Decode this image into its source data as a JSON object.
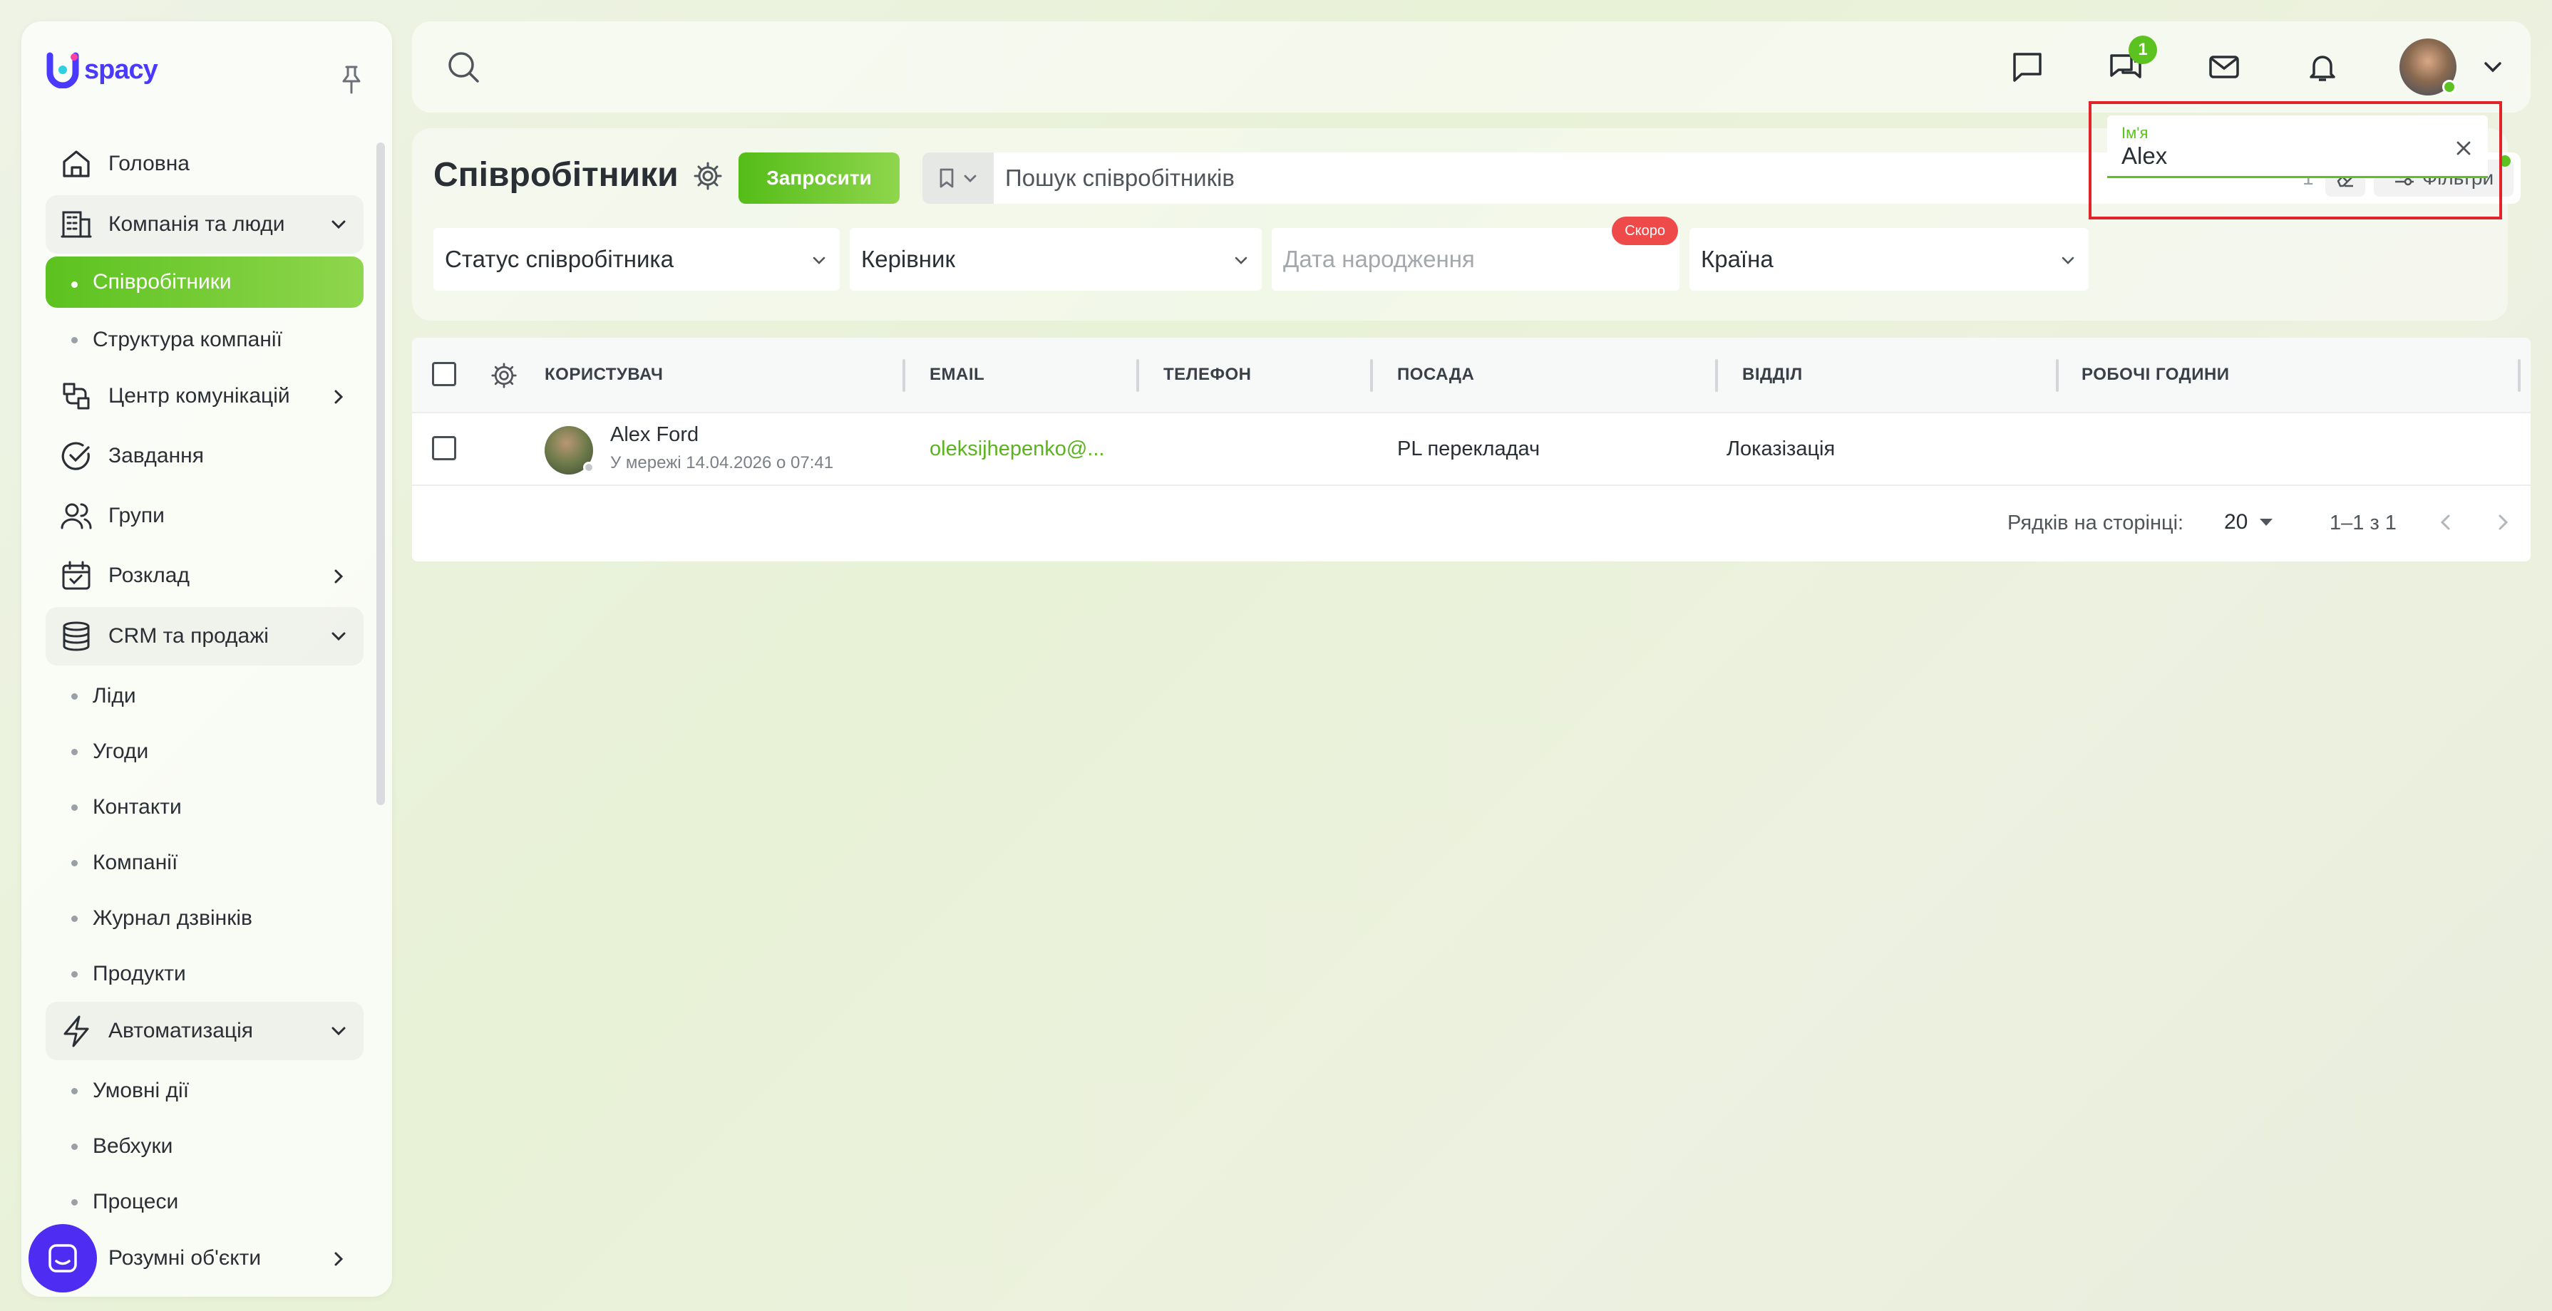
{
  "brand": {
    "logo_text": "spacy",
    "accent": "#5cc21f",
    "brand_color": "#4a3aff"
  },
  "sidebar": {
    "items": [
      {
        "label": "Головна",
        "icon": "home-icon"
      },
      {
        "label": "Компанія та люди",
        "icon": "building-icon",
        "expanded": true
      },
      {
        "label": "Співробітники",
        "sub": true,
        "active": true
      },
      {
        "label": "Структура компанії",
        "sub": true
      },
      {
        "label": "Центр комунікацій",
        "icon": "communication-icon"
      },
      {
        "label": "Завдання",
        "icon": "task-check-icon"
      },
      {
        "label": "Групи",
        "icon": "users-icon"
      },
      {
        "label": "Розклад",
        "icon": "calendar-icon"
      },
      {
        "label": "CRM та продажі",
        "icon": "database-icon",
        "expanded": true
      },
      {
        "label": "Ліди",
        "sub": true
      },
      {
        "label": "Угоди",
        "sub": true
      },
      {
        "label": "Контакти",
        "sub": true
      },
      {
        "label": "Компанії",
        "sub": true
      },
      {
        "label": "Журнал дзвінків",
        "sub": true
      },
      {
        "label": "Продукти",
        "sub": true
      },
      {
        "label": "Автоматизація",
        "icon": "lightning-icon",
        "expanded": true
      },
      {
        "label": "Умовні дії",
        "sub": true
      },
      {
        "label": "Вебхуки",
        "sub": true
      },
      {
        "label": "Процеси",
        "sub": true
      },
      {
        "label": "Розумні об'єкти",
        "icon": "smart-object-icon"
      }
    ]
  },
  "topbar": {
    "chat_badge": "1"
  },
  "page": {
    "title": "Співробітники",
    "invite_label": "Запросити",
    "search_placeholder": "Пошук співробітників",
    "search_count": "1",
    "filters_label": "Фільтри"
  },
  "filters": {
    "status": "Статус співробітника",
    "manager": "Керівник",
    "birthdate": "Дата народження",
    "soon_badge": "Скоро",
    "country": "Країна",
    "name_label": "Ім'я",
    "name_value": "Alex"
  },
  "table": {
    "columns": [
      "КОРИСТУВАЧ",
      "EMAIL",
      "ТЕЛЕФОН",
      "ПОСАДА",
      "ВІДДІЛ",
      "РОБОЧІ ГОДИНИ"
    ],
    "rows": [
      {
        "name": "Alex Ford",
        "status": "У мережі 14.04.2026 о 07:41",
        "email": "oleksijhepenko@...",
        "phone": "",
        "position": "PL перекладач",
        "department": "Локазізація",
        "hours": ""
      }
    ]
  },
  "pager": {
    "rows_per_page_label": "Рядків на сторінці:",
    "rows_per_page": "20",
    "range": "1–1 з 1"
  }
}
